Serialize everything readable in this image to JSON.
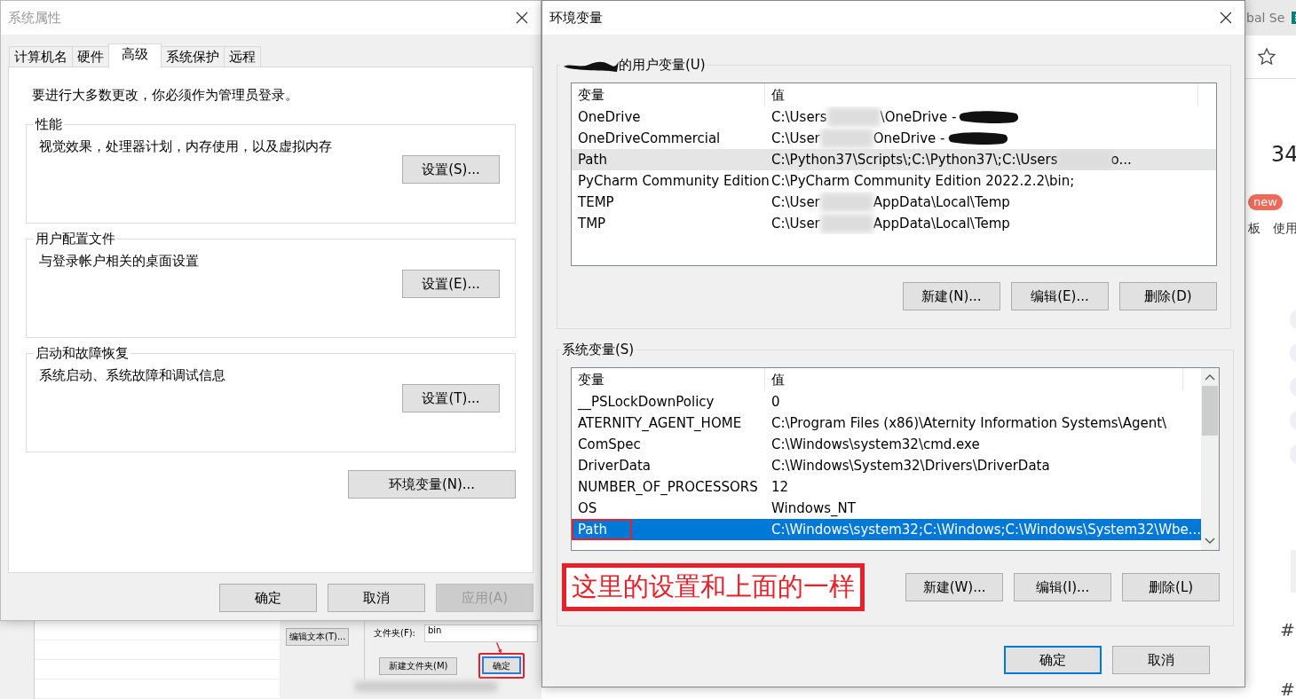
{
  "browser": {
    "tab_fragment": "bal Se",
    "number": "34",
    "badge": "new",
    "menu_items": [
      "板",
      "使用"
    ],
    "hashes": [
      "#",
      "#"
    ]
  },
  "file_dialog": {
    "edit_button": "编辑文本(T)...",
    "folder_label": "文件夹(F):",
    "folder_value": "bin",
    "buttons": [
      {
        "label": "新建文件夹(M)",
        "annotated": false
      },
      {
        "label": "确定",
        "annotated": true
      }
    ]
  },
  "system_properties": {
    "title": "系统属性",
    "active": false,
    "tabs": [
      {
        "label": "计算机名",
        "selected": false
      },
      {
        "label": "硬件",
        "selected": false
      },
      {
        "label": "高级",
        "selected": true
      },
      {
        "label": "系统保护",
        "selected": false
      },
      {
        "label": "远程",
        "selected": false
      }
    ],
    "notice": "要进行大多数更改，你必须作为管理员登录。",
    "groups": [
      {
        "title": "性能",
        "description": "视觉效果，处理器计划，内存使用，以及虚拟内存",
        "button": "设置(S)..."
      },
      {
        "title": "用户配置文件",
        "description": "与登录帐户相关的桌面设置",
        "button": "设置(E)..."
      },
      {
        "title": "启动和故障恢复",
        "description": "系统启动、系统故障和调试信息",
        "button": "设置(T)..."
      }
    ],
    "env_button": "环境变量(N)...",
    "buttons": [
      {
        "label": "确定",
        "disabled": false
      },
      {
        "label": "取消",
        "disabled": false
      },
      {
        "label": "应用(A)",
        "disabled": true
      }
    ]
  },
  "env_vars": {
    "title": "环境变量",
    "active": true,
    "user_group": {
      "title": "的用户变量(U)",
      "title_redacted": true,
      "focused": false,
      "scrollbar": false,
      "columns": [
        "变量",
        "值"
      ],
      "rows": [
        {
          "name": "OneDrive",
          "segments": [
            "C:\\Users",
            "\\OneDrive - "
          ],
          "end_redacted": true,
          "selected": false,
          "annotated": false
        },
        {
          "name": "OneDriveCommercial",
          "segments": [
            "C:\\User",
            "OneDrive - "
          ],
          "end_redacted": true,
          "selected": false,
          "annotated": false
        },
        {
          "name": "Path",
          "segments": [
            "C:\\Python37\\Scripts\\;C:\\Python37\\;C:\\Users",
            "o..."
          ],
          "end_redacted": false,
          "selected": true,
          "annotated": false
        },
        {
          "name": "PyCharm Community Edition",
          "segments": [
            "C:\\PyCharm Community Edition 2022.2.2\\bin;"
          ],
          "end_redacted": false,
          "selected": false,
          "annotated": false
        },
        {
          "name": "TEMP",
          "segments": [
            "C:\\User",
            "AppData\\Local\\Temp"
          ],
          "end_redacted": false,
          "selected": false,
          "annotated": false
        },
        {
          "name": "TMP",
          "segments": [
            "C:\\User",
            "AppData\\Local\\Temp"
          ],
          "end_redacted": false,
          "selected": false,
          "annotated": false
        }
      ],
      "buttons": [
        "新建(N)...",
        "编辑(E)...",
        "删除(D)"
      ]
    },
    "system_group": {
      "title": "系统变量(S)",
      "title_redacted": false,
      "focused": true,
      "scrollbar": true,
      "columns": [
        "变量",
        "值"
      ],
      "rows": [
        {
          "name": "__PSLockDownPolicy",
          "segments": [
            "0"
          ],
          "end_redacted": false,
          "selected": false,
          "annotated": false
        },
        {
          "name": "ATERNITY_AGENT_HOME",
          "segments": [
            "C:\\Program Files (x86)\\Aternity Information Systems\\Agent\\"
          ],
          "end_redacted": false,
          "selected": false,
          "annotated": false
        },
        {
          "name": "ComSpec",
          "segments": [
            "C:\\Windows\\system32\\cmd.exe"
          ],
          "end_redacted": false,
          "selected": false,
          "annotated": false
        },
        {
          "name": "DriverData",
          "segments": [
            "C:\\Windows\\System32\\Drivers\\DriverData"
          ],
          "end_redacted": false,
          "selected": false,
          "annotated": false
        },
        {
          "name": "NUMBER_OF_PROCESSORS",
          "segments": [
            "12"
          ],
          "end_redacted": false,
          "selected": false,
          "annotated": false
        },
        {
          "name": "OS",
          "segments": [
            "Windows_NT"
          ],
          "end_redacted": false,
          "selected": false,
          "annotated": false
        },
        {
          "name": "Path",
          "segments": [
            "C:\\Windows\\system32;C:\\Windows;C:\\Windows\\System32\\Wbe..."
          ],
          "end_redacted": false,
          "selected": true,
          "annotated": true
        }
      ],
      "annotation": "这里的设置和上面的一样",
      "buttons": [
        "新建(W)...",
        "编辑(I)...",
        "删除(L)"
      ]
    },
    "buttons": [
      {
        "label": "确定",
        "default": true
      },
      {
        "label": "取消",
        "default": false
      }
    ]
  }
}
